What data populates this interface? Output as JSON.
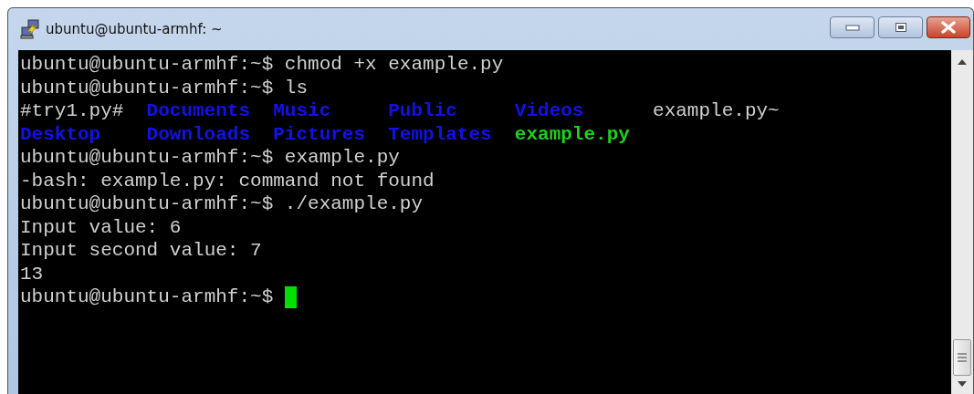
{
  "window": {
    "title": "ubuntu@ubuntu-armhf: ~"
  },
  "terminal": {
    "lines": [
      {
        "kind": "text",
        "text": "ubuntu@ubuntu-armhf:~$ chmod +x example.py"
      },
      {
        "kind": "text",
        "text": "ubuntu@ubuntu-armhf:~$ ls"
      },
      {
        "kind": "listing",
        "entries": [
          {
            "name": "#try1.py#",
            "kind": "file"
          },
          {
            "name": "Documents",
            "kind": "directory"
          },
          {
            "name": "Music",
            "kind": "directory"
          },
          {
            "name": "Public",
            "kind": "directory"
          },
          {
            "name": "Videos",
            "kind": "directory"
          },
          {
            "name": "example.py~",
            "kind": "file"
          },
          {
            "name": "Desktop",
            "kind": "directory"
          },
          {
            "name": "Downloads",
            "kind": "directory"
          },
          {
            "name": "Pictures",
            "kind": "directory"
          },
          {
            "name": "Templates",
            "kind": "directory"
          },
          {
            "name": "example.py",
            "kind": "executable"
          }
        ]
      },
      {
        "kind": "text",
        "text": "ubuntu@ubuntu-armhf:~$ example.py"
      },
      {
        "kind": "text",
        "text": "-bash: example.py: command not found"
      },
      {
        "kind": "text",
        "text": "ubuntu@ubuntu-armhf:~$ ./example.py"
      },
      {
        "kind": "text",
        "text": "Input value: 6"
      },
      {
        "kind": "text",
        "text": "Input second value: 7"
      },
      {
        "kind": "text",
        "text": "13"
      },
      {
        "kind": "prompt",
        "text": "ubuntu@ubuntu-armhf:~$"
      }
    ]
  }
}
